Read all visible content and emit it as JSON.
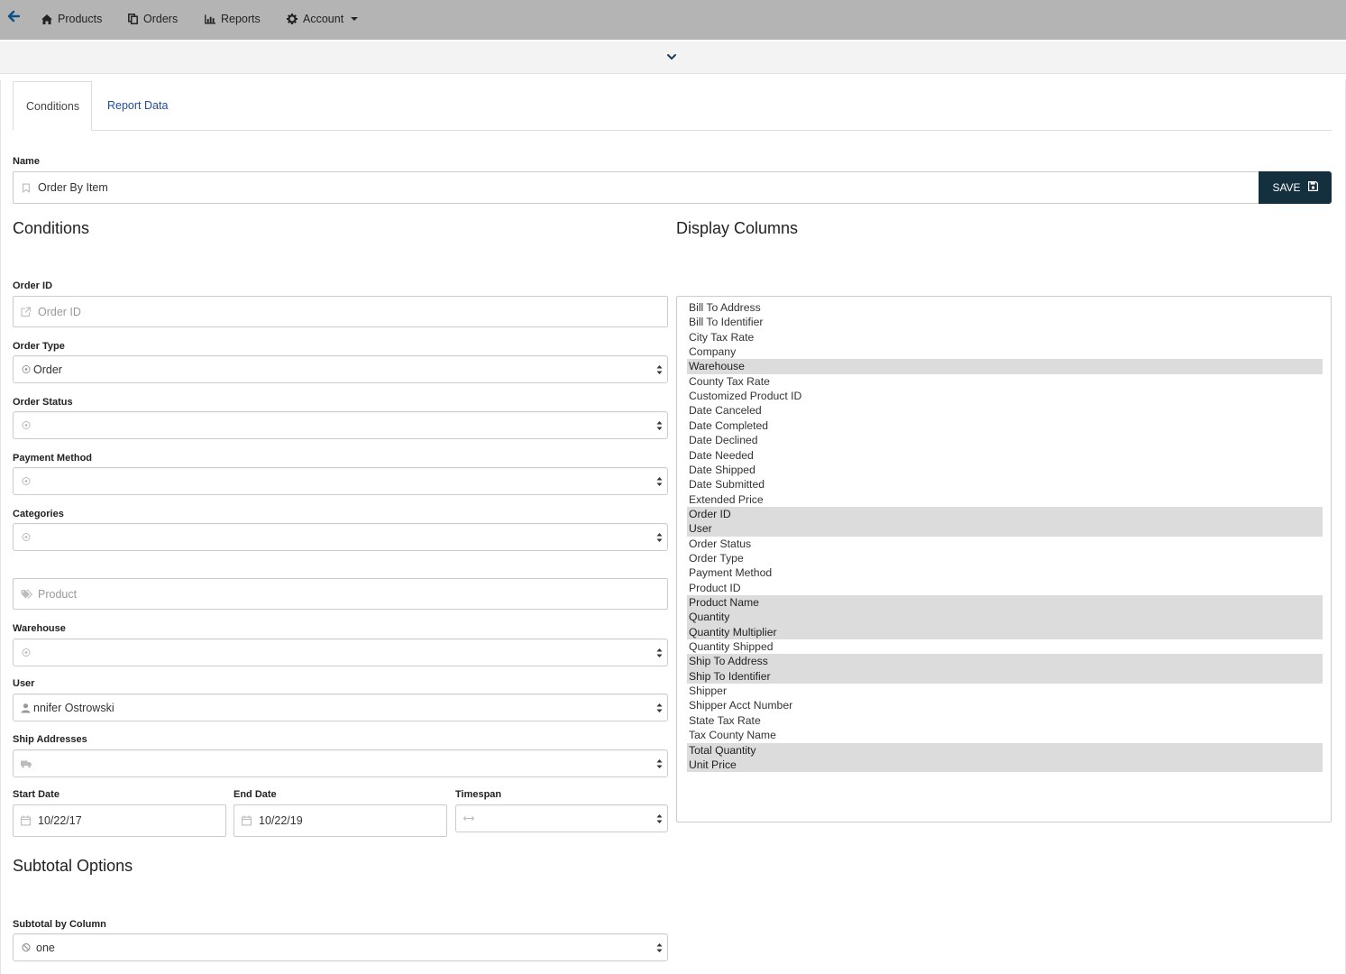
{
  "nav": {
    "products": "Products",
    "orders": "Orders",
    "reports": "Reports",
    "account": "Account"
  },
  "tabs": {
    "conditions": "Conditions",
    "report_data": "Report Data"
  },
  "name_field": {
    "label": "Name",
    "value": "Order By Item"
  },
  "save_label": "SAVE",
  "sections": {
    "conditions": "Conditions",
    "display_columns": "Display Columns",
    "subtotal_options": "Subtotal Options"
  },
  "form": {
    "order_id": {
      "label": "Order ID",
      "placeholder": "Order ID"
    },
    "order_type": {
      "label": "Order Type",
      "value": "Order"
    },
    "order_status": {
      "label": "Order Status",
      "value": ""
    },
    "payment_method": {
      "label": "Payment Method",
      "value": ""
    },
    "categories": {
      "label": "Categories",
      "value": ""
    },
    "product": {
      "placeholder": "Product"
    },
    "warehouse": {
      "label": "Warehouse",
      "value": ""
    },
    "user": {
      "label": "User",
      "value": "nnifer Ostrowski"
    },
    "ship_addresses": {
      "label": "Ship Addresses",
      "value": ""
    },
    "start_date": {
      "label": "Start Date",
      "value": "10/22/17"
    },
    "end_date": {
      "label": "End Date",
      "value": "10/22/19"
    },
    "timespan": {
      "label": "Timespan",
      "value": ""
    },
    "subtotal_by_column": {
      "label": "Subtotal by Column",
      "value": "one"
    }
  },
  "display_columns": [
    {
      "label": "Bill To Address",
      "selected": false
    },
    {
      "label": "Bill To Identifier",
      "selected": false
    },
    {
      "label": "City Tax Rate",
      "selected": false
    },
    {
      "label": "Company",
      "selected": false
    },
    {
      "label": "Warehouse",
      "selected": true
    },
    {
      "label": "County Tax Rate",
      "selected": false
    },
    {
      "label": "Customized Product ID",
      "selected": false
    },
    {
      "label": "Date Canceled",
      "selected": false
    },
    {
      "label": "Date Completed",
      "selected": false
    },
    {
      "label": "Date Declined",
      "selected": false
    },
    {
      "label": "Date Needed",
      "selected": false
    },
    {
      "label": "Date Shipped",
      "selected": false
    },
    {
      "label": "Date Submitted",
      "selected": false
    },
    {
      "label": "Extended Price",
      "selected": false
    },
    {
      "label": "Order ID",
      "selected": true
    },
    {
      "label": "User",
      "selected": true
    },
    {
      "label": "Order Status",
      "selected": false
    },
    {
      "label": "Order Type",
      "selected": false
    },
    {
      "label": "Payment Method",
      "selected": false
    },
    {
      "label": "Product ID",
      "selected": false
    },
    {
      "label": "Product Name",
      "selected": true
    },
    {
      "label": "Quantity",
      "selected": true
    },
    {
      "label": "Quantity Multiplier",
      "selected": true
    },
    {
      "label": "Quantity Shipped",
      "selected": false
    },
    {
      "label": "Ship To Address",
      "selected": true
    },
    {
      "label": "Ship To Identifier",
      "selected": true
    },
    {
      "label": "Shipper",
      "selected": false
    },
    {
      "label": "Shipper Acct Number",
      "selected": false
    },
    {
      "label": "State Tax Rate",
      "selected": false
    },
    {
      "label": "Tax County Name",
      "selected": false
    },
    {
      "label": "Total Quantity",
      "selected": true
    },
    {
      "label": "Unit Price",
      "selected": true
    }
  ],
  "colors": {
    "navbar": "#b4b4b4",
    "link": "#1f4e99",
    "save_button": "#14303f",
    "selected_row": "#dcdcdc"
  },
  "icons": {
    "back": "arrow-left-icon",
    "products": "home-icon",
    "orders": "copy-icon",
    "reports": "bar-chart-icon",
    "account": "gear-icon",
    "name": "bookmark-icon",
    "save": "floppy-disk-icon",
    "order_id": "external-link-icon",
    "product": "tags-icon",
    "ship_addresses": "truck-icon",
    "date": "calendar-icon",
    "timespan": "arrows-horizontal-icon"
  }
}
